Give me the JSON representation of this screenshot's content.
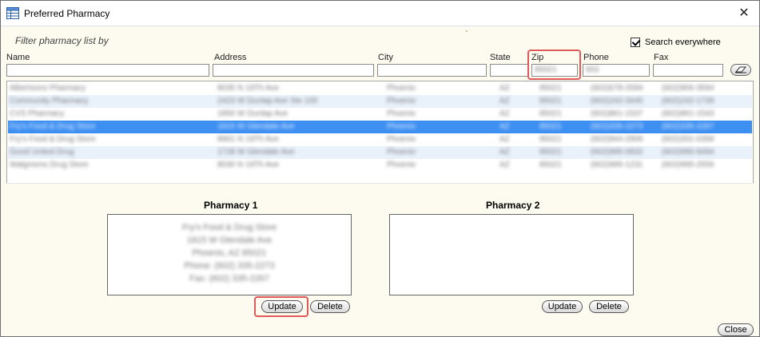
{
  "window": {
    "title": "Preferred Pharmacy",
    "close_glyph": "✕",
    "title_icon": "table-icon"
  },
  "filter": {
    "caption": "Filter pharmacy list by",
    "search_everywhere_label": "Search everywhere",
    "search_everywhere_checked": true,
    "columns": {
      "name": "Name",
      "address": "Address",
      "city": "City",
      "state": "State",
      "zip": "Zip",
      "phone": "Phone",
      "fax": "Fax"
    },
    "values": {
      "name": "",
      "address": "",
      "city": "",
      "state": "",
      "zip": "85021",
      "phone": "602",
      "fax": ""
    },
    "clear_icon": "eraser-icon"
  },
  "pharmacies": [
    {
      "name": "Albertsons Pharmacy",
      "address": "8035 N 19Th Ave",
      "city": "Phoenix",
      "state": "AZ",
      "zip": "85021",
      "phone": "(602)678-2594",
      "fax": "(602)906-3594",
      "selected": false
    },
    {
      "name": "Community Pharmacy",
      "address": "2423 W Dunlap Ave Ste 100",
      "city": "Phoenix",
      "state": "AZ",
      "zip": "85021",
      "phone": "(602)242-3445",
      "fax": "(602)242-1739",
      "selected": false
    },
    {
      "name": "CVS Pharmacy",
      "address": "1850 W Dunlap Ave",
      "city": "Phoenix",
      "state": "AZ",
      "zip": "85021",
      "phone": "(602)861-1537",
      "fax": "(602)861-1543",
      "selected": false
    },
    {
      "name": "Fry's Food & Drug Store",
      "address": "1815 W Glendale Ave",
      "city": "Phoenix",
      "state": "AZ",
      "zip": "85021",
      "phone": "(602)335-2273",
      "fax": "(602)335-2267",
      "selected": true
    },
    {
      "name": "Fry's Food & Drug Store",
      "address": "8901 N 19Th Ave",
      "city": "Phoenix",
      "state": "AZ",
      "zip": "85021",
      "phone": "(602)944-2906",
      "fax": "(602)331-0358",
      "selected": false
    },
    {
      "name": "Good United Drug",
      "address": "1728 W Glendale Ave",
      "city": "Phoenix",
      "state": "AZ",
      "zip": "85021",
      "phone": "(602)995-0832",
      "fax": "(602)995-9494",
      "selected": false
    },
    {
      "name": "Walgreens Drug Store",
      "address": "8030 N 19Th Ave",
      "city": "Phoenix",
      "state": "AZ",
      "zip": "85021",
      "phone": "(602)995-1231",
      "fax": "(602)995-2556",
      "selected": false
    }
  ],
  "pharmacy1": {
    "title": "Pharmacy 1",
    "lines": [
      "Fry's Food & Drug Store",
      "1815 W Glendale Ave",
      "Phoenix, AZ 85021",
      "Phone: (602) 335-2273",
      "Fax: (602) 335-2267"
    ],
    "update_label": "Update",
    "delete_label": "Delete"
  },
  "pharmacy2": {
    "title": "Pharmacy 2",
    "lines": [],
    "update_label": "Update",
    "delete_label": "Delete"
  },
  "footer": {
    "close_label": "Close"
  },
  "colors": {
    "selection": "#3d8ff2",
    "alt_row": "#e9f1fb",
    "client_bg": "#fdfbf0",
    "callout": "#e05a5a"
  }
}
